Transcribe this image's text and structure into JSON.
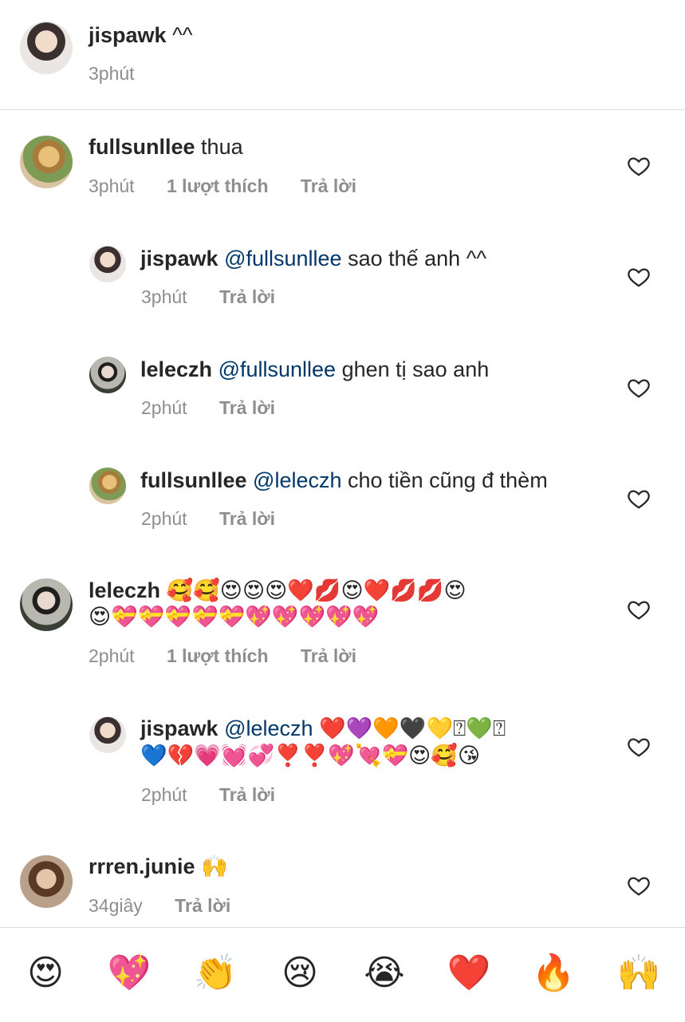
{
  "caption": {
    "username": "jispawk",
    "text": "^^",
    "time": "3phút"
  },
  "comments": [
    {
      "username": "fullsunllee",
      "text": "thua",
      "time": "3phút",
      "likes": "1 lượt thích",
      "reply": "Trả lời"
    },
    {
      "username": "jispawk",
      "mention": "@fullsunllee",
      "text": "sao thế anh ^^",
      "time": "3phút",
      "reply": "Trả lời"
    },
    {
      "username": "leleczh",
      "mention": "@fullsunllee",
      "text": "ghen tị sao anh",
      "time": "2phút",
      "reply": "Trả lời"
    },
    {
      "username": "fullsunllee",
      "mention": "@leleczh",
      "text": "cho tiền cũng đ thèm",
      "time": "2phút",
      "reply": "Trả lời"
    },
    {
      "username": "leleczh",
      "text1": "🥰🥰😍😍😍❤️💋😍❤️💋💋😍",
      "text2": "😍💝💝💝💝💝💖💖💖💖💖",
      "time": "2phút",
      "likes": "1 lượt thích",
      "reply": "Trả lời"
    },
    {
      "username": "jispawk",
      "mention": "@leleczh",
      "text1": "❤️💜🧡🖤💛⍰💚⍰",
      "text2": "💙💔💗💓💞❣️❣️💖💘💝😍🥰😘",
      "time": "2phút",
      "reply": "Trả lời"
    },
    {
      "username": "rrren.junie",
      "text": "🙌",
      "time": "34giây",
      "reply": "Trả lời"
    }
  ],
  "quick_reactions": [
    "😍",
    "💖",
    "👏",
    "😢",
    "😭",
    "❤️",
    "🔥",
    "🙌"
  ]
}
